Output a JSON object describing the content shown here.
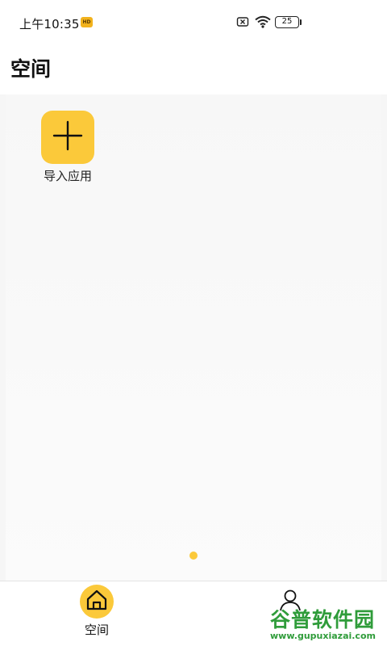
{
  "status_bar": {
    "time": "上午10:35",
    "badge": "HD",
    "battery": "25"
  },
  "header": {
    "title": "空间"
  },
  "apps": [
    {
      "label": "导入应用",
      "icon": "plus-icon"
    }
  ],
  "bottom_nav": {
    "items": [
      {
        "label": "空间",
        "icon": "home-icon",
        "active": true
      },
      {
        "label": "",
        "icon": "user-icon",
        "active": false
      }
    ]
  },
  "watermark": {
    "text": "谷普软件园",
    "url": "www.gupuxiazai.com"
  },
  "colors": {
    "accent": "#fbc93a",
    "watermark": "#2f9c3a"
  }
}
